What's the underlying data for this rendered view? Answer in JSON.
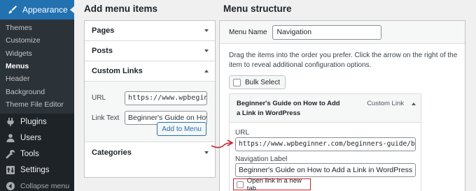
{
  "sidebar": {
    "top": {
      "label": "Appearance",
      "icon": "paintbrush-icon"
    },
    "sub_items": [
      {
        "label": "Themes",
        "current": false
      },
      {
        "label": "Customize",
        "current": false
      },
      {
        "label": "Widgets",
        "current": false
      },
      {
        "label": "Menus",
        "current": true
      },
      {
        "label": "Header",
        "current": false
      },
      {
        "label": "Background",
        "current": false
      },
      {
        "label": "Theme File Editor",
        "current": false
      }
    ],
    "main_items": [
      {
        "label": "Plugins",
        "icon": "plugin-icon"
      },
      {
        "label": "Users",
        "icon": "users-icon"
      },
      {
        "label": "Tools",
        "icon": "wrench-icon"
      },
      {
        "label": "Settings",
        "icon": "settings-icon"
      }
    ],
    "collapse_label": "Collapse menu"
  },
  "add_items": {
    "title": "Add menu items",
    "sections": {
      "pages": "Pages",
      "posts": "Posts",
      "custom_links": "Custom Links",
      "categories": "Categories"
    },
    "custom_links": {
      "url_label": "URL",
      "url_value": "https://www.wpbeginner.com/beginners-guide/",
      "link_text_label": "Link Text",
      "link_text_value": "Beginner's Guide on How to Add a Link in WordPress",
      "add_button": "Add to Menu"
    }
  },
  "structure": {
    "title": "Menu structure",
    "menu_name_label": "Menu Name",
    "menu_name_value": "Navigation",
    "instructions": "Drag the items into the order you prefer. Click the arrow on the right of the item to reveal additional configuration options.",
    "bulk_select": "Bulk Select",
    "item": {
      "title": "Beginner's Guide on How to Add a Link in WordPress",
      "type": "Custom Link",
      "url_label": "URL",
      "url_value": "https://www.wpbeginner.com/beginners-guide/beginners-guide-on-how-to-add-a-link-in-wordpress/",
      "nav_label_label": "Navigation Label",
      "nav_label_value": "Beginner's Guide on How to Add a Link in WordPress",
      "open_new_tab_label": "Open link in a new tab"
    }
  },
  "colors": {
    "sidebar_bg": "#1d2327",
    "accent": "#2271b1",
    "highlight": "#c6262e"
  }
}
